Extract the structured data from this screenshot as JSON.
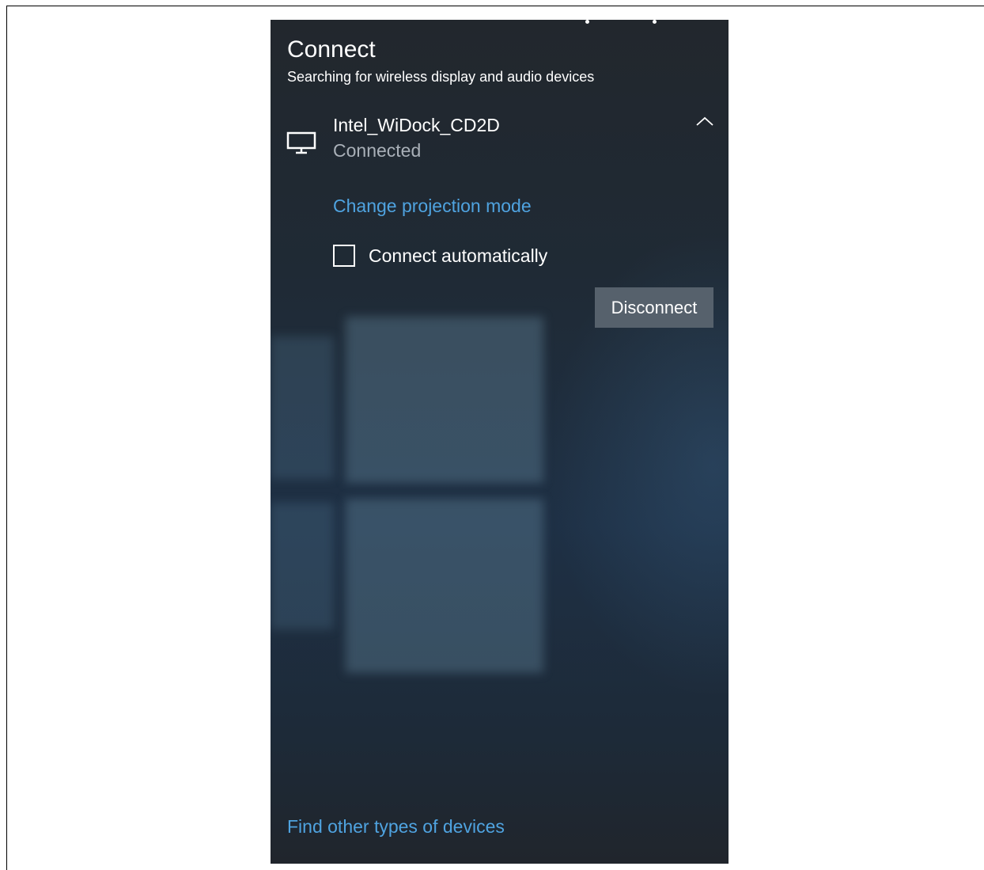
{
  "panel": {
    "title": "Connect",
    "subtitle": "Searching for wireless display and audio devices"
  },
  "device": {
    "icon": "monitor-icon",
    "name": "Intel_WiDock_CD2D",
    "status": "Connected",
    "expand_icon": "chevron-up-icon"
  },
  "actions": {
    "change_projection": "Change projection mode",
    "connect_automatically": "Connect automatically",
    "connect_automatically_checked": false,
    "disconnect": "Disconnect"
  },
  "footer": {
    "find_other": "Find other types of devices"
  },
  "colors": {
    "link": "#4fa3e0",
    "button_bg": "#56616c",
    "panel_bg": "#1f2a35",
    "secondary_text": "#a9b0b8"
  }
}
